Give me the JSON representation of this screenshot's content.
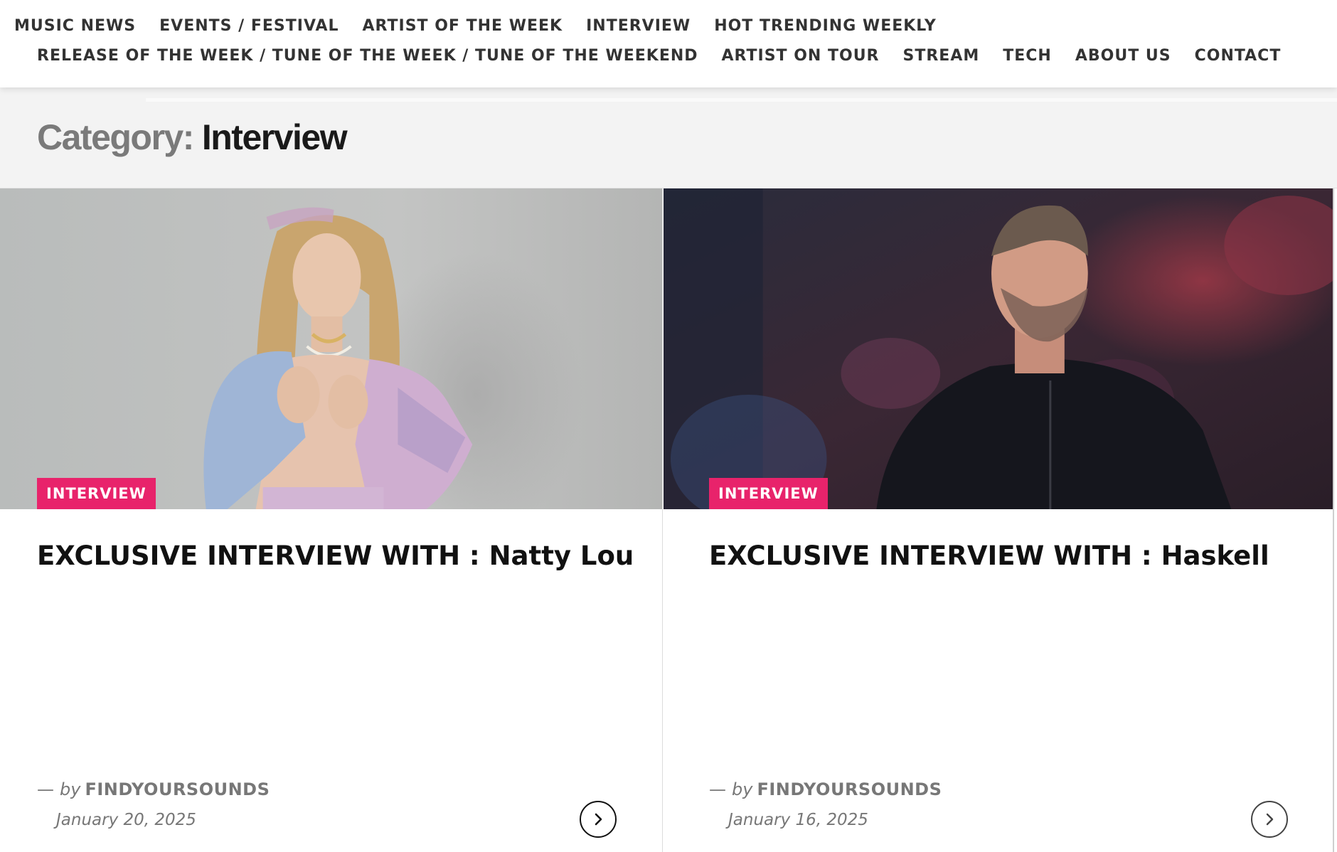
{
  "nav": {
    "row1": [
      "MUSIC NEWS",
      "EVENTS / FESTIVAL",
      "ARTIST OF THE WEEK",
      "INTERVIEW",
      "HOT TRENDING WEEKLY"
    ],
    "row2": [
      "RELEASE OF THE WEEK / TUNE OF THE WEEK / TUNE OF THE WEEKEND",
      "ARTIST ON TOUR",
      "STREAM",
      "TECH",
      "ABOUT US",
      "CONTACT"
    ]
  },
  "category": {
    "prefix": "Category:",
    "name": "Interview"
  },
  "posts": [
    {
      "badge": "INTERVIEW",
      "title": "EXCLUSIVE INTERVIEW WITH : Natty Lou",
      "dash": "—",
      "by": "by",
      "author": "FINDYOURSOUNDS",
      "date": "January 20, 2025",
      "image_icon": "photo-woman-denim-jacket"
    },
    {
      "badge": "INTERVIEW",
      "title": "EXCLUSIVE INTERVIEW WITH : Haskell",
      "dash": "—",
      "by": "by",
      "author": "FINDYOURSOUNDS",
      "date": "January 16, 2025",
      "image_icon": "photo-man-dark-jacket"
    }
  ],
  "colors": {
    "accent": "#e8236b",
    "header_bg": "#f3f3f3"
  },
  "icons": {
    "read_more": "chevron-right-icon"
  }
}
